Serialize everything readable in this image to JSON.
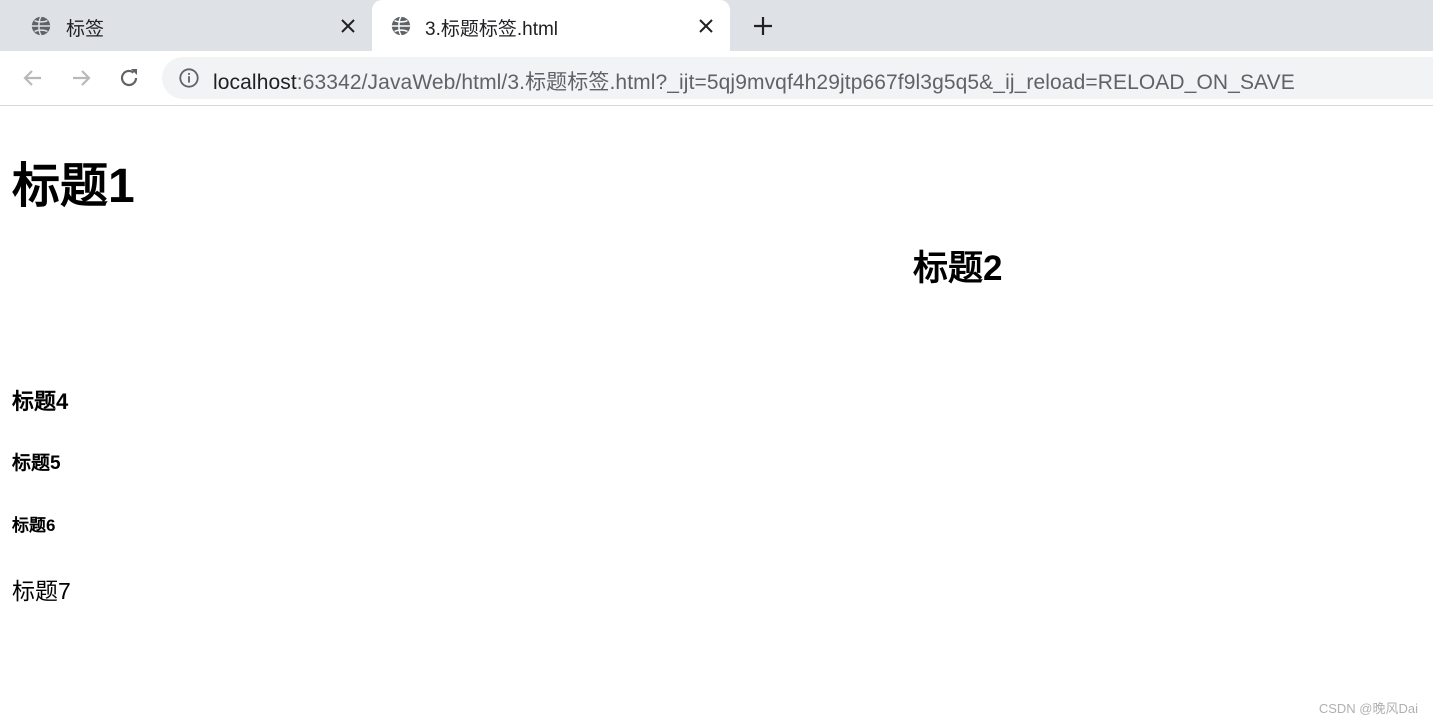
{
  "tabs": [
    {
      "title": "标签",
      "active": false,
      "icon": "globe-icon"
    },
    {
      "title": "3.标题标签.html",
      "active": true,
      "icon": "globe-icon"
    }
  ],
  "toolbar": {
    "url_host": "localhost",
    "url_rest": ":63342/JavaWeb/html/3.标题标签.html?_ijt=5qj9mvqf4h29jtp667f9l3g5q5&_ij_reload=RELOAD_ON_SAVE"
  },
  "page": {
    "h1": "标题1",
    "h2": "标题2",
    "h4": "标题4",
    "h5": "标题5",
    "h6": "标题6",
    "h7": "标题7"
  },
  "watermark": "CSDN @晚风Dai",
  "colors": {
    "tabstrip_bg": "#dee1e6",
    "omnibox_bg": "#f1f3f4",
    "icon_color": "#5f6368"
  }
}
